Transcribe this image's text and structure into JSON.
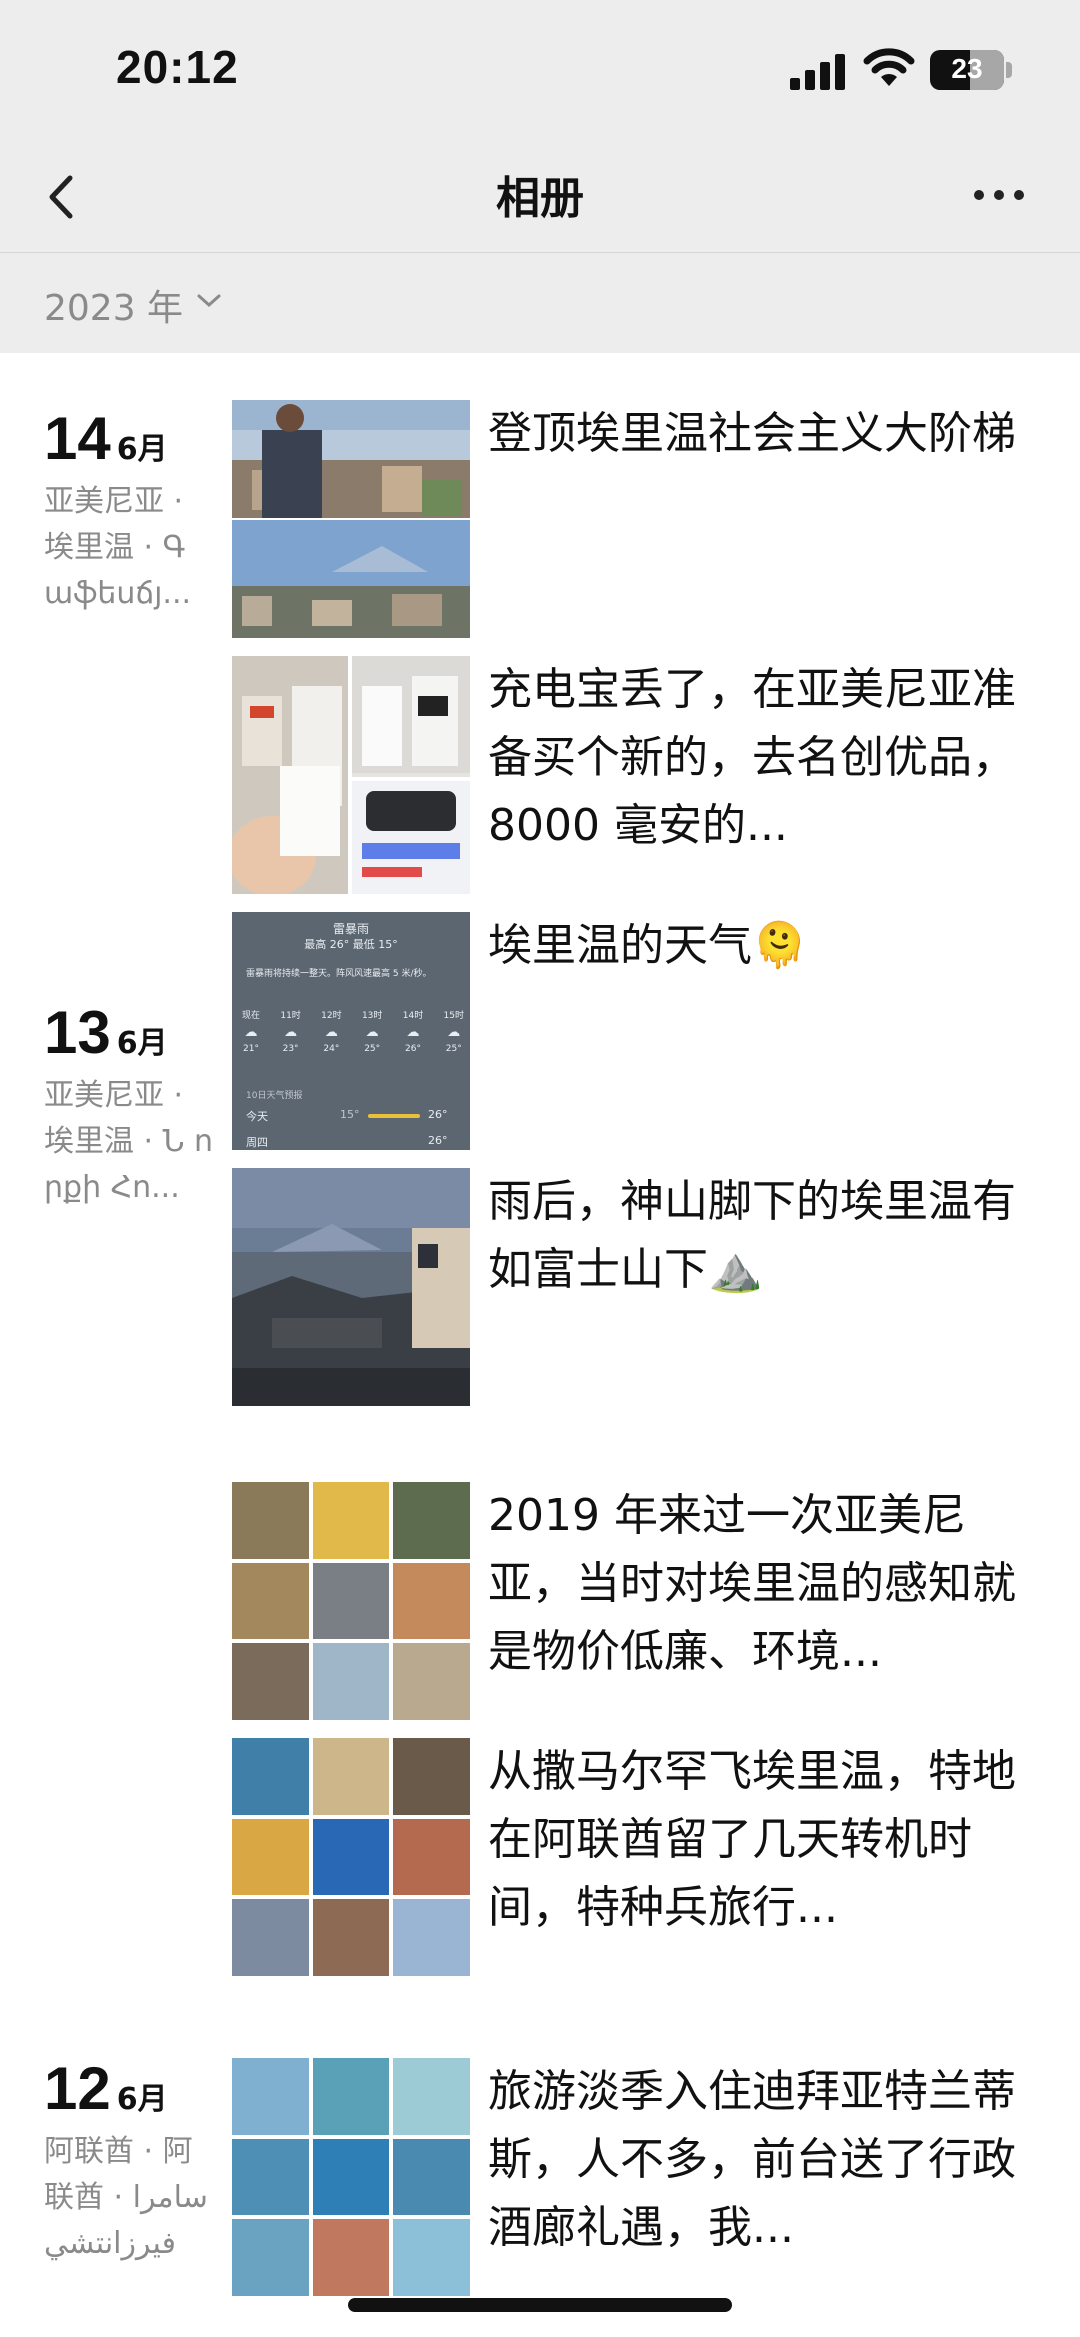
{
  "status": {
    "time": "20:12",
    "battery": "23"
  },
  "nav": {
    "title": "相册"
  },
  "year": {
    "label": "2023 年"
  },
  "days": [
    {
      "day": "14",
      "month": "6月",
      "location": "亚美尼亚 · 埃里温 · Գ աֆեսճյ..."
    },
    {
      "day": "13",
      "month": "6月",
      "location": "亚美尼亚 · 埃里温 · Ն որքի Հո..."
    },
    {
      "day": "12",
      "month": "6月",
      "location": "阿联酋 · 阿联酋 · سامرا فيرزانتشي"
    }
  ],
  "posts": [
    {
      "caption": "登顶埃里温社会主义大阶梯"
    },
    {
      "caption": "充电宝丢了，在亚美尼亚准备买个新的，去名创优品，8000 毫安的..."
    },
    {
      "caption": "埃里温的天气🫠"
    },
    {
      "caption": "雨后，神山脚下的埃里温有如富士山下⛰️"
    },
    {
      "caption": "2019 年来过一次亚美尼亚，当时对埃里温的感知就是物价低廉、环境..."
    },
    {
      "caption": "从撒马尔罕飞埃里温，特地在阿联酋留了几天转机时间，特种兵旅行..."
    },
    {
      "caption": "旅游淡季入住迪拜亚特兰蒂斯，人不多，前台送了行政酒廊礼遇，我..."
    }
  ],
  "weather_thumb": {
    "title": "雷暴雨",
    "range": "最高 26° 最低 15°",
    "desc": "雷暴雨将持续一整天。阵风风速最高 5 米/秒。",
    "hours": [
      "现在",
      "11时",
      "12时",
      "13时",
      "14时",
      "15时"
    ],
    "temps": [
      "21°",
      "23°",
      "24°",
      "25°",
      "26°",
      "25°"
    ],
    "forecast_label": "10日天气预报",
    "today_label": "今天",
    "today_low": "15°",
    "today_high": "26°",
    "next_label": "周四",
    "next_high": "26°"
  },
  "colors": {
    "header_bg": "#ededed",
    "muted": "#8a8a8a",
    "text": "#111111"
  }
}
